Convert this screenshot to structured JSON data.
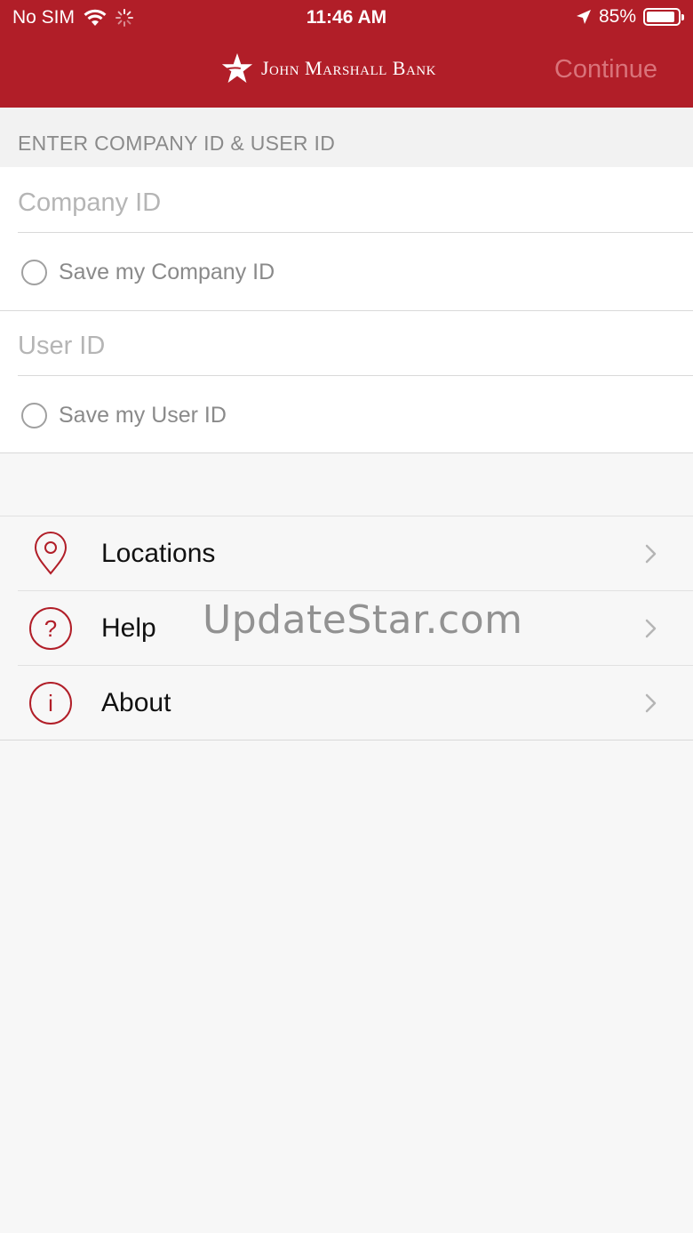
{
  "status_bar": {
    "carrier": "No SIM",
    "time": "11:46 AM",
    "battery": "85%"
  },
  "header": {
    "brand": "John Marshall Bank",
    "continue_label": "Continue"
  },
  "form": {
    "section_title": "ENTER COMPANY ID & USER ID",
    "company_id_placeholder": "Company ID",
    "save_company_label": "Save my Company ID",
    "user_id_placeholder": "User ID",
    "save_user_label": "Save my User ID"
  },
  "menu": {
    "items": [
      {
        "label": "Locations",
        "icon": "location-pin-icon"
      },
      {
        "label": "Help",
        "icon": "question-circle-icon"
      },
      {
        "label": "About",
        "icon": "info-circle-icon"
      }
    ]
  },
  "watermark": "UpdateStar.com",
  "colors": {
    "brand_red": "#b11e28",
    "icon_red": "#b11e28",
    "continue_disabled": "#d9737a"
  }
}
